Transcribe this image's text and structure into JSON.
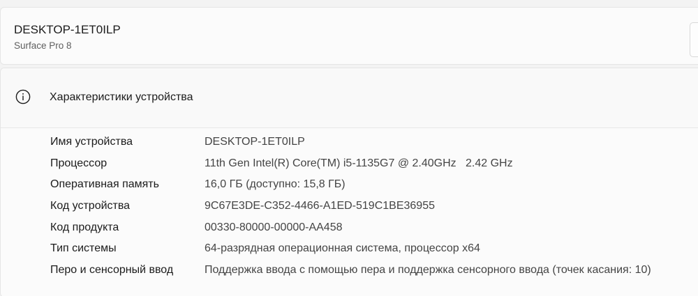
{
  "device": {
    "name": "DESKTOP-1ET0ILP",
    "model": "Surface Pro 8"
  },
  "specs": {
    "title": "Характеристики устройства",
    "items": [
      {
        "label": "Имя устройства",
        "value": "DESKTOP-1ET0ILP"
      },
      {
        "label": "Процессор",
        "value": "11th Gen Intel(R) Core(TM) i5-1135G7 @ 2.40GHz   2.42 GHz"
      },
      {
        "label": "Оперативная память",
        "value": "16,0 ГБ (доступно: 15,8 ГБ)"
      },
      {
        "label": "Код устройства",
        "value": "9C67E3DE-C352-4466-A1ED-519C1BE36955"
      },
      {
        "label": "Код продукта",
        "value": "00330-80000-00000-AA458"
      },
      {
        "label": "Тип системы",
        "value": "64-разрядная операционная система, процессор x64"
      },
      {
        "label": "Перо и сенсорный ввод",
        "value": "Поддержка ввода с помощью пера и поддержка сенсорного ввода (точек касания: 10)"
      }
    ]
  },
  "icons": {
    "info": "info-icon"
  }
}
